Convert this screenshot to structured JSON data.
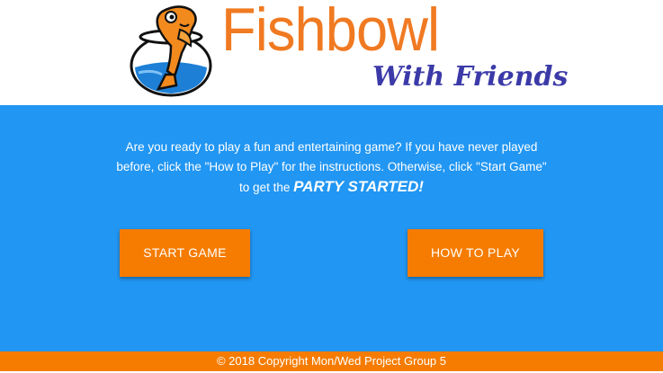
{
  "header": {
    "logo_title": "Fishbowl",
    "logo_subtitle": "With Friends",
    "logo_icon": "fishbowl-icon"
  },
  "main": {
    "intro_line1": "Are you ready to play a fun and entertaining game? If you have never played",
    "intro_line2": "before, click the \"How to Play\" for the instructions. Otherwise, click \"Start Game\"",
    "intro_line3_prefix": "to get the ",
    "intro_line3_emphasis": "PARTY STARTED!",
    "start_button": "START GAME",
    "how_button": "HOW TO PLAY"
  },
  "footer": {
    "copyright": "© 2018 Copyright Mon/Wed Project Group 5"
  },
  "colors": {
    "main_bg": "#2196f3",
    "accent_orange": "#f57c00",
    "logo_orange": "#f07a22",
    "logo_blue": "#3b3aa8"
  }
}
